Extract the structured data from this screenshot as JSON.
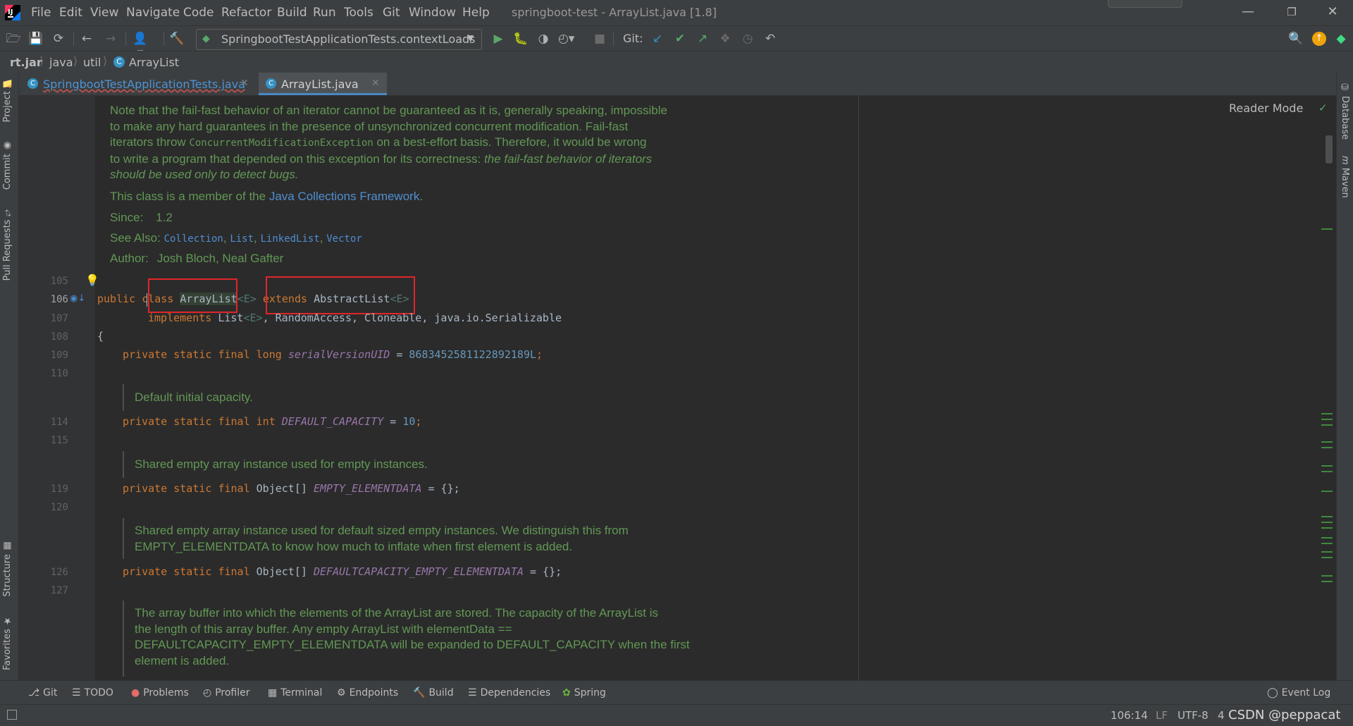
{
  "window": {
    "title": "springboot-test - ArrayList.java [1.8]",
    "menu": [
      "File",
      "Edit",
      "View",
      "Navigate",
      "Code",
      "Refactor",
      "Build",
      "Run",
      "Tools",
      "Git",
      "Window",
      "Help"
    ],
    "minimize_icon": "minimize-icon",
    "restore_icon": "restore-icon",
    "close_icon": "close-icon"
  },
  "toolbar": {
    "run_config": "SpringbootTestApplicationTests.contextLoads",
    "git_label": "Git:"
  },
  "breadcrumb": [
    "rt.jar",
    "java",
    "util",
    "ArrayList"
  ],
  "left_tabs": [
    "Project",
    "Commit",
    "Pull Requests",
    "Structure",
    "Favorites"
  ],
  "right_tabs": [
    "Database",
    "Maven"
  ],
  "tabs": [
    {
      "label": "SpringbootTestApplicationTests.java",
      "active": false
    },
    {
      "label": "ArrayList.java",
      "active": true
    }
  ],
  "editor": {
    "reader_mode": "Reader Mode",
    "doc_top": {
      "p1_a": "Note that the fail-fast behavior of an iterator cannot be guaranteed as it is, generally speaking, impossible",
      "p1_b": "to make any hard guarantees in the presence of unsynchronized concurrent modification. Fail-fast",
      "p1_c1": "iterators throw ",
      "p1_c_code": "ConcurrentModificationException",
      "p1_c2": " on a best-effort basis. Therefore, it would be wrong",
      "p1_d1": "to write a program that depended on this exception for its correctness: ",
      "p1_d_em": "the fail-fast behavior of iterators",
      "p1_e_em": "should be used only to detect bugs.",
      "p2_a": "This class is a member of the ",
      "p2_link": "Java Collections Framework",
      "p2_b": ".",
      "since_label": "Since:",
      "since_value": "1.2",
      "see_also_label": "See Also:",
      "see_also": [
        "Collection",
        "List",
        "LinkedList",
        "Vector"
      ],
      "author_label": "Author:",
      "author_value": "Josh Bloch, Neal Gafter"
    },
    "lines": {
      "l105": "105",
      "l106": "106",
      "l107": "107",
      "l108": "108",
      "l109": "109",
      "l110": "110",
      "l114": "114",
      "l115": "115",
      "l119": "119",
      "l120": "120",
      "l126": "126",
      "l127": "127"
    },
    "code": {
      "c106_public": "public",
      "c106_class": "class",
      "c106_name": "ArrayList",
      "c106_gen1": "<E>",
      "c106_extends": "extends",
      "c106_super": "AbstractList",
      "c106_gen2": "<E>",
      "c107_impl": "implements",
      "c107_rest1": "List",
      "c107_gen": "<E>",
      "c107_rest2": ", RandomAccess, Cloneable, java.io.Serializable",
      "c108": "{",
      "c109_mod": "private static final long",
      "c109_field": "serialVersionUID",
      "c109_eq": " = ",
      "c109_val": "8683452581122892189L",
      "c109_semi": ";",
      "c114_mod": "private static final int",
      "c114_field": "DEFAULT_CAPACITY",
      "c114_eq": " = ",
      "c114_val": "10",
      "c114_semi": ";",
      "c119_mod": "private static final",
      "c119_type": " Object[] ",
      "c119_field": "EMPTY_ELEMENTDATA",
      "c119_rest": " = {};",
      "c126_mod": "private static final",
      "c126_type": " Object[] ",
      "c126_field": "DEFAULTCAPACITY_EMPTY_ELEMENTDATA",
      "c126_rest": " = {};"
    },
    "doc_default_capacity": "Default initial capacity.",
    "doc_empty": "Shared empty array instance used for empty instances.",
    "doc_default_empty_a": "Shared empty array instance used for default sized empty instances. We distinguish this from",
    "doc_default_empty_b": "EMPTY_ELEMENTDATA to know how much to inflate when first element is added.",
    "doc_buffer_a": "The array buffer into which the elements of the ArrayList are stored. The capacity of the ArrayList is",
    "doc_buffer_b": "the length of this array buffer. Any empty ArrayList with elementData ==",
    "doc_buffer_c": "DEFAULTCAPACITY_EMPTY_ELEMENTDATA will be expanded to DEFAULT_CAPACITY when the first",
    "doc_buffer_d": "element is added."
  },
  "bottom_tools": [
    "Git",
    "TODO",
    "Problems",
    "Profiler",
    "Terminal",
    "Endpoints",
    "Build",
    "Dependencies",
    "Spring"
  ],
  "event_log": "Event Log",
  "status": {
    "position": "106:14",
    "line_sep": "LF",
    "encoding": "UTF-8",
    "indent": "4",
    "watermark": "CSDN @peppacat"
  },
  "colors": {
    "accent_green": "#629755",
    "keyword": "#cc7832",
    "highlight_box": "#e0262b"
  }
}
